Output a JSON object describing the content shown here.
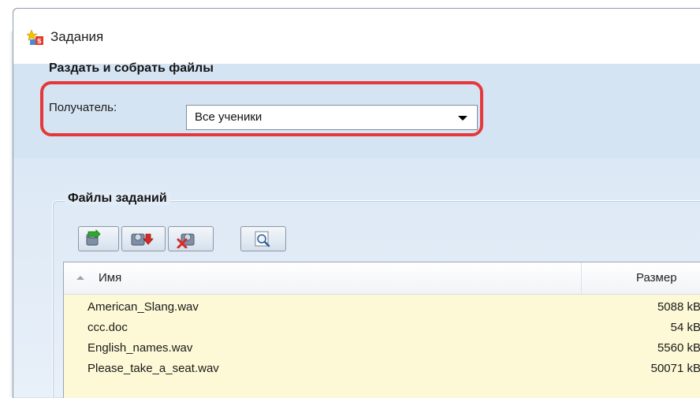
{
  "window": {
    "title": "Задания"
  },
  "distribute": {
    "section_title": "Раздать и собрать файлы",
    "recipient_label": "Получатель:",
    "recipient_value": "Все ученики"
  },
  "files": {
    "group_title": "Файлы заданий",
    "toolbar": [
      {
        "icon": "add-file-icon"
      },
      {
        "icon": "collect-files-icon"
      },
      {
        "icon": "delete-file-icon"
      },
      {
        "icon": "preview-icon"
      }
    ],
    "columns": {
      "name": "Имя",
      "size": "Размер"
    },
    "rows": [
      {
        "name": "American_Slang.wav",
        "size": "5088 kB"
      },
      {
        "name": "ccc.doc",
        "size": "54 kB"
      },
      {
        "name": "English_names.wav",
        "size": "5560 kB"
      },
      {
        "name": "Please_take_a_seat.wav",
        "size": "50071 kB"
      }
    ]
  },
  "colors": {
    "highlight": "#e5383b",
    "panel": "#d5e4f3",
    "row_bg": "#fdf9d6"
  }
}
